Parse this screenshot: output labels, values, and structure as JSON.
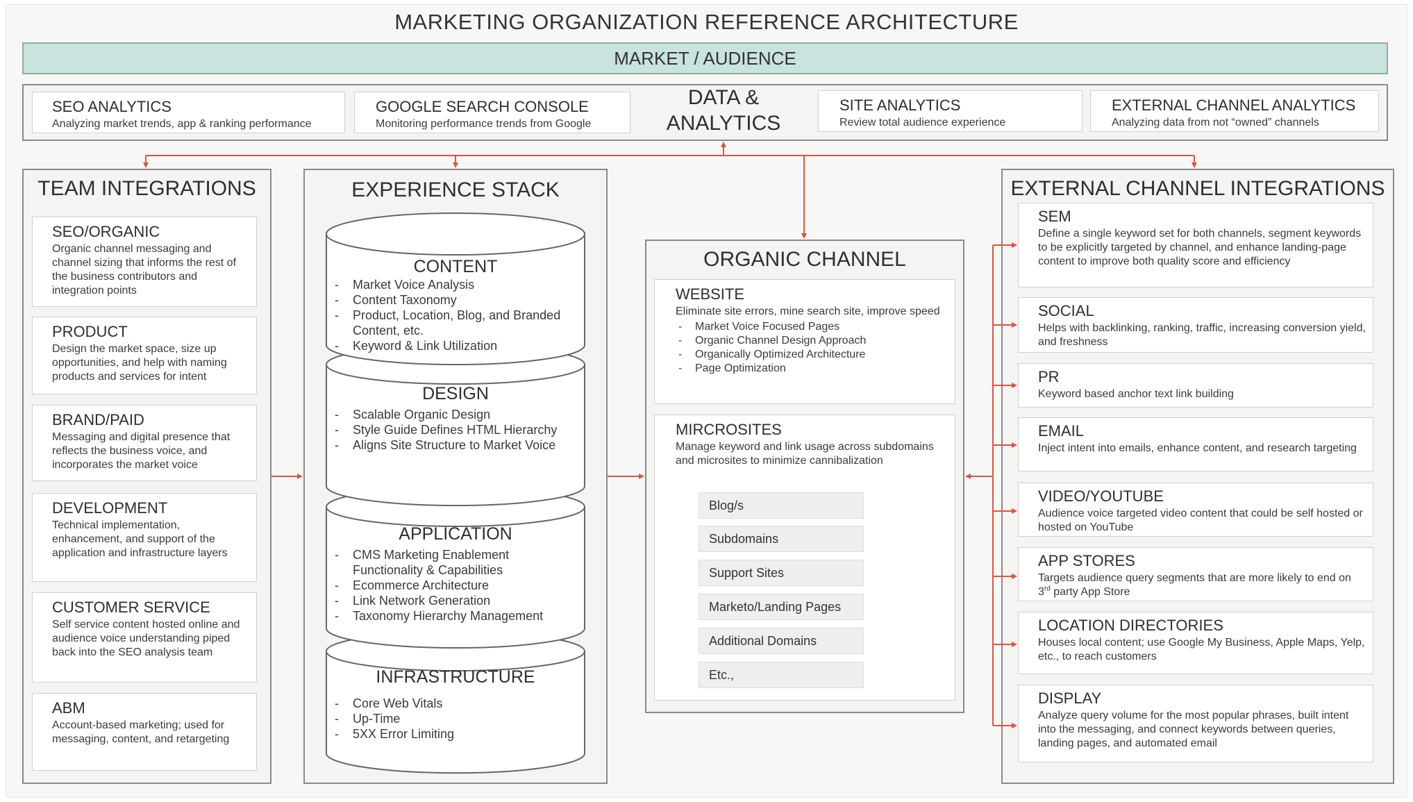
{
  "title": "MARKETING ORGANIZATION REFERENCE ARCHITECTURE",
  "banner": "MARKET / AUDIENCE",
  "data_analytics": {
    "label_line1": "DATA &",
    "label_line2": "ANALYTICS",
    "items": [
      {
        "title": "SEO ANALYTICS",
        "text": "Analyzing market trends, app & ranking performance"
      },
      {
        "title": "GOOGLE SEARCH CONSOLE",
        "text": "Monitoring performance trends from Google"
      },
      {
        "title": "SITE ANALYTICS",
        "text": "Review total audience experience"
      },
      {
        "title": "EXTERNAL CHANNEL ANALYTICS",
        "text": "Analyzing data from not “owned” channels"
      }
    ]
  },
  "team_integrations": {
    "title": "TEAM INTEGRATIONS",
    "items": [
      {
        "title": "SEO/ORGANIC",
        "text": "Organic channel messaging and channel sizing that informs the rest of the business contributors and integration points"
      },
      {
        "title": "PRODUCT",
        "text": "Design the market space, size up opportunities, and help with naming products and services for intent"
      },
      {
        "title": "BRAND/PAID",
        "text": "Messaging and digital presence that reflects the business voice, and incorporates the market voice"
      },
      {
        "title": "DEVELOPMENT",
        "text": "Technical implementation, enhancement, and support of the application and infrastructure layers"
      },
      {
        "title": "CUSTOMER SERVICE",
        "text": "Self service content hosted online and audience voice understanding piped back into the SEO analysis team"
      },
      {
        "title": "ABM",
        "text": "Account-based marketing; used for messaging, content, and retargeting"
      }
    ]
  },
  "experience_stack": {
    "title": "EXPERIENCE STACK",
    "layers": [
      {
        "title": "CONTENT",
        "items": [
          "Market Voice Analysis",
          "Content Taxonomy",
          "Product, Location, Blog, and Branded Content, etc.",
          "Keyword &  Link Utilization"
        ]
      },
      {
        "title": "DESIGN",
        "items": [
          "Scalable Organic Design",
          "Style Guide Defines HTML Hierarchy",
          "Aligns Site Structure to Market Voice"
        ]
      },
      {
        "title": "APPLICATION",
        "items": [
          "CMS Marketing Enablement Functionality & Capabilities",
          "Ecommerce Architecture",
          "Link Network Generation",
          "Taxonomy Hierarchy Management"
        ]
      },
      {
        "title": "INFRASTRUCTURE",
        "items": [
          "Core Web Vitals",
          "Up-Time",
          "5XX Error Limiting"
        ]
      }
    ]
  },
  "organic_channel": {
    "title": "ORGANIC CHANNEL",
    "website": {
      "title": "WEBSITE",
      "text": "Eliminate site errors, mine search site, improve speed",
      "items": [
        "Market Voice Focused Pages",
        "Organic Channel Design Approach",
        "Organically Optimized Architecture",
        "Page Optimization"
      ]
    },
    "microsites": {
      "title": "MIRCROSITES",
      "text": "Manage keyword and link usage across subdomains and microsites to minimize cannibalization",
      "chips": [
        "Blog/s",
        "Subdomains",
        "Support Sites",
        "Marketo/Landing Pages",
        "Additional Domains",
        "Etc.,"
      ]
    }
  },
  "external_channel_integrations": {
    "title": "EXTERNAL CHANNEL INTEGRATIONS",
    "items": [
      {
        "title": "SEM",
        "text": "Define a single keyword set for both channels, segment keywords to be explicitly targeted by channel, and enhance landing-page content to improve both quality score and efficiency"
      },
      {
        "title": "SOCIAL",
        "text": "Helps with backlinking, ranking, traffic, increasing conversion yield, and freshness"
      },
      {
        "title": "PR",
        "text": "Keyword based anchor text link building"
      },
      {
        "title": "EMAIL",
        "text": "Inject intent into emails, enhance content, and research targeting"
      },
      {
        "title": "VIDEO/YOUTUBE",
        "text": "Audience voice targeted video content that could be self hosted or hosted on YouTube"
      },
      {
        "title": "APP STORES",
        "text_before": "Targets audience query segments that are more likely to end on 3",
        "text_sup": "rd",
        "text_after": " party App Store"
      },
      {
        "title": "LOCATION DIRECTORIES",
        "text": "Houses local content; use Google My Business, Apple Maps, Yelp, etc., to reach customers"
      },
      {
        "title": "DISPLAY",
        "text": "Analyze query volume for the most popular phrases, built intent into the messaging, and connect keywords between queries, landing pages, and automated email"
      }
    ]
  },
  "colors": {
    "arrow": "#e0533f",
    "banner": "#c9e3df",
    "panel_border": "#8a8a8a"
  }
}
